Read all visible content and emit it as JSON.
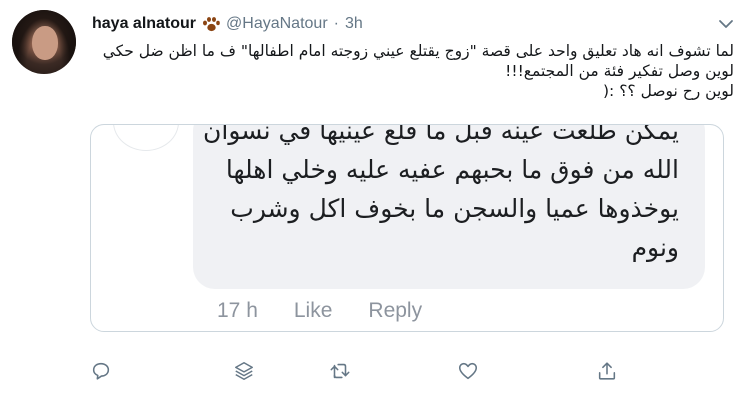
{
  "tweet": {
    "display_name": "haya alnatour",
    "handle": "@HayaNatour",
    "separator": "·",
    "time": "3h",
    "text_lines": [
      "لما تشوف انه هاد تعليق واحد على قصة \"زوج يقتلع عيني زوجته امام اطفالها\"  ف ما اظن ضل حكي",
      "لوين وصل تفكير فئة من المجتمع!!!",
      "لوين رح نوصل ؟؟ :("
    ]
  },
  "embedded_comment": {
    "lines": [
      "يمكن طلعت عينه قبل ما قلع عينيها في نسوان",
      "الله من فوق ما بحبهم عفيه عليه وخلي اهلها",
      "يوخذوها عميا والسجن ما بخوف اكل وشرب",
      "ونوم"
    ],
    "time": "17 h",
    "like_label": "Like",
    "reply_label": "Reply"
  },
  "icons": {
    "badge": "paw-icon",
    "menu": "chevron-down-icon",
    "actions": [
      "reply-icon",
      "stack-icon",
      "retweet-icon",
      "like-icon",
      "share-icon"
    ]
  },
  "colors": {
    "muted": "#657786",
    "paw": "#8b4513",
    "bubble": "#f0f1f4"
  }
}
